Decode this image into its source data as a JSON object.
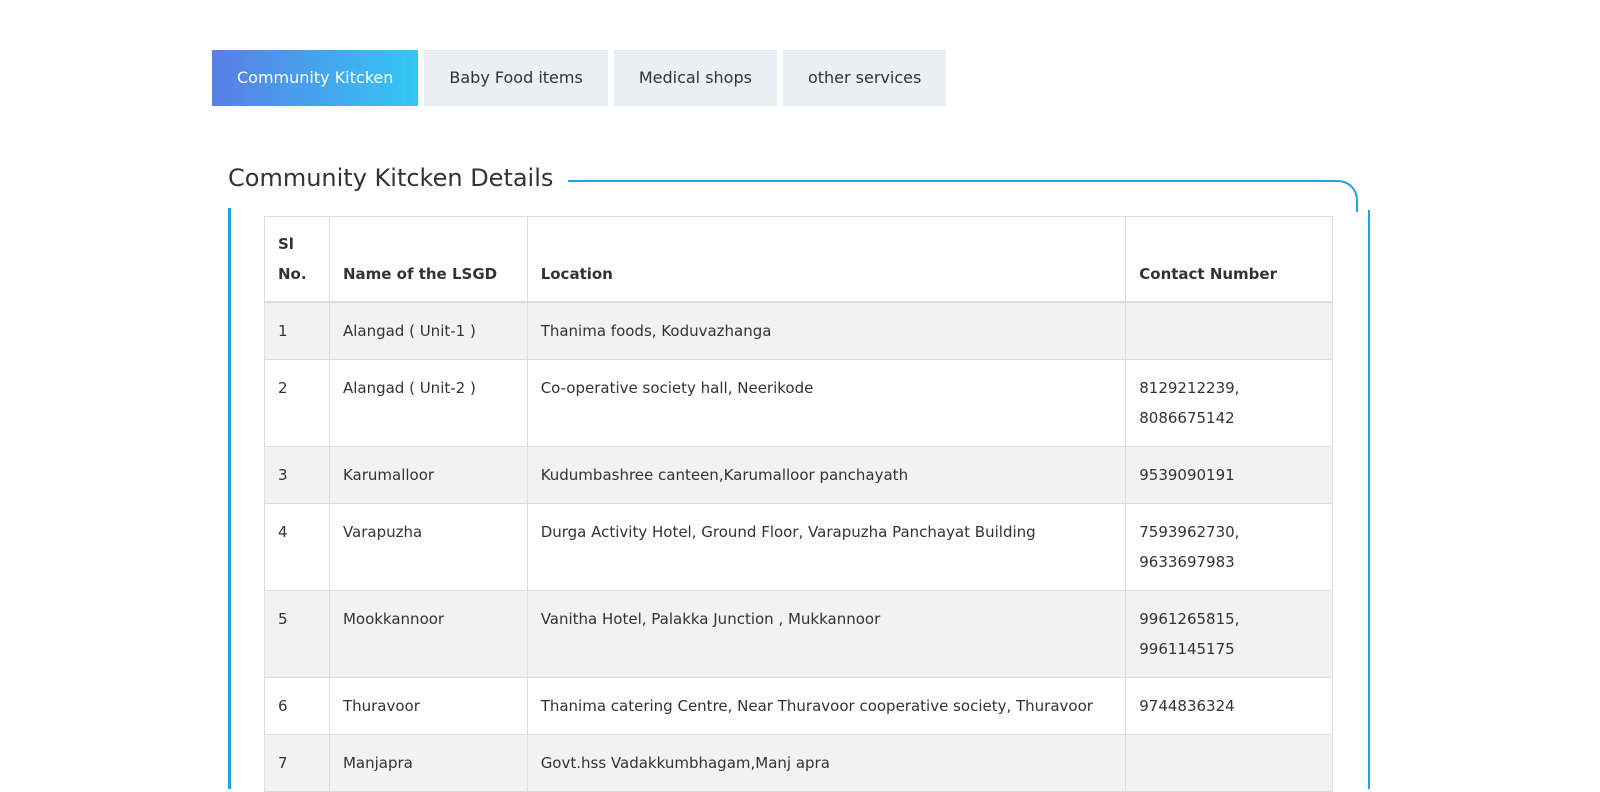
{
  "tabs": [
    {
      "label": "Community Kitcken",
      "active": true
    },
    {
      "label": "Baby Food items",
      "active": false
    },
    {
      "label": "Medical shops",
      "active": false
    },
    {
      "label": "other services",
      "active": false
    }
  ],
  "section": {
    "title": "Community Kitcken Details"
  },
  "table": {
    "headers": {
      "sl": "Sl No.",
      "name": "Name of the LSGD",
      "location": "Location",
      "contact": "Contact Number"
    },
    "rows": [
      {
        "sl": "1",
        "name": "Alangad ( Unit-1 )",
        "location": "Thanima foods, Koduvazhanga",
        "contact": [
          "",
          ""
        ]
      },
      {
        "sl": "2",
        "name": "Alangad ( Unit-2 )",
        "location": "Co-operative society hall, Neerikode",
        "contact": [
          "8129212239,",
          "8086675142"
        ]
      },
      {
        "sl": "3",
        "name": "Karumalloor",
        "location": "Kudumbashree canteen,Karumalloor panchayath",
        "contact": [
          "9539090191",
          ""
        ]
      },
      {
        "sl": "4",
        "name": "Varapuzha",
        "location": "Durga Activity Hotel, Ground Floor, Varapuzha Panchayat Building",
        "contact": [
          "7593962730,",
          "9633697983"
        ]
      },
      {
        "sl": "5",
        "name": "Mookkannoor",
        "location": "Vanitha Hotel, Palakka Junction , Mukkannoor",
        "contact": [
          "9961265815,",
          "9961145175"
        ]
      },
      {
        "sl": "6",
        "name": "Thuravoor",
        "location": "Thanima catering Centre, Near Thuravoor cooperative society, Thuravoor",
        "contact": [
          "9744836324",
          ""
        ]
      },
      {
        "sl": "7",
        "name": "Manjapra",
        "location": "Govt.hss Vadakkumbhagam,Manj apra",
        "contact": [
          "",
          ""
        ]
      }
    ]
  },
  "colors": {
    "accent": "#1ba4e3",
    "tab_gradient_start": "#5a7ee6",
    "tab_gradient_end": "#33c7f5",
    "tab_inactive": "#e9eff2",
    "row_stripe": "#f2f2f2"
  }
}
